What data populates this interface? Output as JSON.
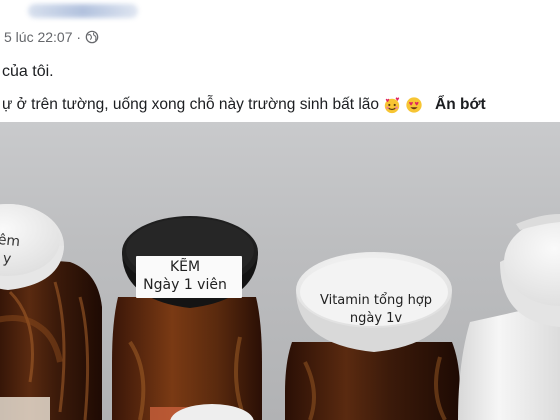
{
  "post": {
    "timestamp": "5 lúc 22:07 ·",
    "privacy_icon": "globe-icon",
    "line1": "của tôi.",
    "line2": "ự ở trên tường, uống xong chỗ này trường sinh bất lão",
    "emojis": [
      "smiling-face-with-hearts-icon",
      "heart-eyes-icon"
    ],
    "see_less": "Ẩn bớt"
  },
  "photo": {
    "bottles": [
      {
        "name": "bottle-left",
        "cap_label": "êm\ny"
      },
      {
        "name": "bottle-kem",
        "cap_label": "KẼM\nNgày 1 viên"
      },
      {
        "name": "bottle-vitamin",
        "cap_label": "Vitamin tổng hợp\nngày 1v"
      },
      {
        "name": "bottle-white-right",
        "cap_label": ""
      }
    ],
    "colors": {
      "wall": "#c0c1c3",
      "white_cap": "#f1f1f1",
      "black_cap": "#1b1b1b",
      "amber_glass": "#3a1a0c",
      "white_bottle": "#eeeeee"
    }
  }
}
